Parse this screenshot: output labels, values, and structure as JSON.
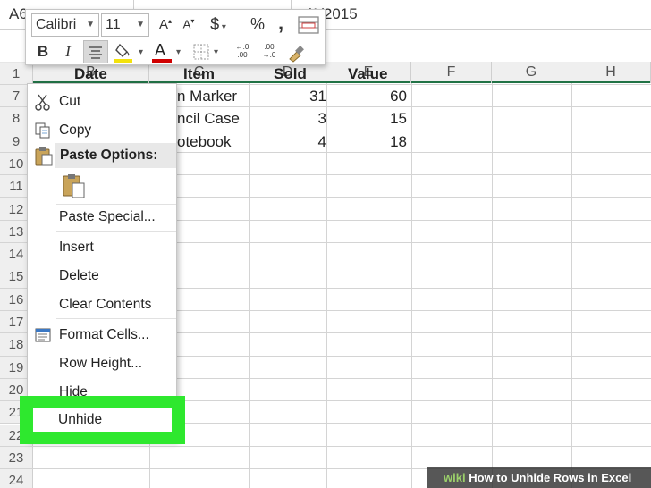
{
  "formula_bar": {
    "name_box": "A6",
    "formula_value": "/1/2015"
  },
  "column_headers": [
    "B",
    "C",
    "D",
    "E",
    "F",
    "G",
    "H"
  ],
  "row_numbers": [
    "1",
    "7",
    "8",
    "9",
    "10",
    "11",
    "12",
    "13",
    "14",
    "15",
    "16",
    "17",
    "18",
    "19",
    "20",
    "21",
    "22",
    "23",
    "24"
  ],
  "table_headers": {
    "date": "Date",
    "item": "Item",
    "sold": "Sold",
    "value": "Value"
  },
  "rows": [
    {
      "item": "n Marker",
      "sold": "31",
      "value": "60"
    },
    {
      "item": "ncil Case",
      "sold": "3",
      "value": "15"
    },
    {
      "item": "otebook",
      "sold": "4",
      "value": "18"
    }
  ],
  "mini_toolbar": {
    "font": "Calibri",
    "size": "11",
    "increase_font": "A",
    "decrease_font": "A",
    "currency": "$",
    "percent": "%",
    "comma": ",",
    "bold": "B",
    "italic": "I",
    "font_color": "A",
    "inc_decimal": ".00",
    "dec_decimal": ".0"
  },
  "context_menu": {
    "cut": "Cut",
    "copy": "Copy",
    "paste_options": "Paste Options:",
    "paste_special": "Paste Special...",
    "insert": "Insert",
    "delete": "Delete",
    "clear_contents": "Clear Contents",
    "format_cells": "Format Cells...",
    "row_height": "Row Height...",
    "hide": "Hide",
    "unhide": "Unhide"
  },
  "watermark": {
    "brand": "wiki",
    "title": "How to Unhide Rows in Excel"
  },
  "colors": {
    "highlight": "#2ee82e",
    "excel_green": "#217346",
    "fill_yellow": "#f3e20c",
    "font_red": "#d00000"
  }
}
